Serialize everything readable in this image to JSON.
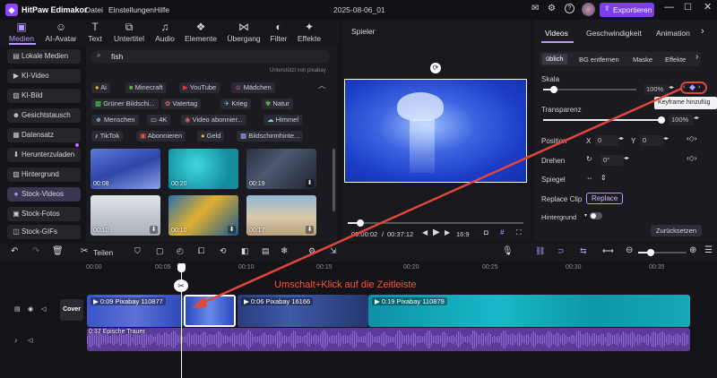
{
  "app": {
    "name": "HitPaw Edimakor",
    "menu": [
      "Datei",
      "Einstellungen",
      "Hilfe"
    ],
    "project_title": "2025-08-06_01",
    "export_label": "Exportieren",
    "accent_color": "#7b3ff2"
  },
  "toolbar": [
    {
      "label": "Medien",
      "icon": "media-icon",
      "active": true
    },
    {
      "label": "AI-Avatar",
      "icon": "avatar-icon"
    },
    {
      "label": "Text",
      "icon": "text-icon"
    },
    {
      "label": "Untertitel",
      "icon": "subtitle-icon"
    },
    {
      "label": "Audio",
      "icon": "audio-icon"
    },
    {
      "label": "Elemente",
      "icon": "elements-icon"
    },
    {
      "label": "Übergang",
      "icon": "transition-icon"
    },
    {
      "label": "Filter",
      "icon": "filter-icon"
    },
    {
      "label": "Effekte",
      "icon": "effects-icon"
    }
  ],
  "sidebar": {
    "items": [
      {
        "label": "Lokale Medien",
        "icon": "folder-icon"
      },
      {
        "label": "KI-Video",
        "icon": "ai-video-icon"
      },
      {
        "label": "KI-Bild",
        "icon": "ai-image-icon"
      },
      {
        "label": "Gesichtstausch",
        "icon": "face-swap-icon"
      },
      {
        "label": "Datensatz",
        "icon": "dataset-icon"
      },
      {
        "label": "Herunterzuladen",
        "icon": "download-icon"
      },
      {
        "label": "Hintergrund",
        "icon": "background-icon"
      },
      {
        "label": "Stock-Videos",
        "icon": "stock-video-icon",
        "active": true
      },
      {
        "label": "Stock-Fotos",
        "icon": "stock-photo-icon"
      },
      {
        "label": "Stock-GIFs",
        "icon": "stock-gif-icon"
      }
    ]
  },
  "media": {
    "search_value": "fish",
    "powered_by": "Unterstützt von pixabay",
    "tags": [
      [
        "Ai",
        "Minecraft",
        "YouTube",
        "Mädchen"
      ],
      [
        "Grüner Bildschi...",
        "Vatertag",
        "Krieg",
        "Natur"
      ],
      [
        "Menschen",
        "4K",
        "Video abonnier...",
        "Himmel"
      ],
      [
        "TikTok",
        "Abonnieren",
        "Geld",
        "Bildschirmhinte..."
      ]
    ],
    "thumbs": [
      {
        "duration": "00:08"
      },
      {
        "duration": "00:20"
      },
      {
        "duration": "00:19"
      },
      {
        "duration": "00:10"
      },
      {
        "duration": "00:10"
      },
      {
        "duration": "00:17"
      }
    ]
  },
  "player": {
    "title": "Spieler",
    "time_current": "00:00:02",
    "time_total": "00:37:12",
    "aspect": "16:9",
    "progress": 0.07
  },
  "props": {
    "tabs": [
      "Videos",
      "Geschwindigkeit",
      "Animation"
    ],
    "subtabs": [
      "üblich",
      "BG entfernen",
      "Maske",
      "Effekte"
    ],
    "scale_label": "Skala",
    "scale_value": "100%",
    "scale_level": 0.12,
    "tooltip": "Keyframe hinzufüg",
    "opacity_label": "Transparenz",
    "opacity_value": "100%",
    "opacity_level": 1.0,
    "position_label": "Position",
    "pos_x_label": "X",
    "pos_x": "0",
    "pos_y_label": "Y",
    "pos_y": "0",
    "rotate_label": "Drehen",
    "rotate_value": "0°",
    "mirror_label": "Spiegel",
    "replace_label": "Replace Clip",
    "replace_button": "Replace",
    "background_label": "Hintergrund",
    "reset_button": "Zurücksetzen"
  },
  "timeline": {
    "split_label": "Teilen",
    "ruler": [
      "00:00",
      "00:05",
      "00:10",
      "00:15",
      "00:20",
      "00:25",
      "00:30",
      "00:35"
    ],
    "cover_label": "Cover",
    "annotation": "Umschalt+Klick auf die Zeitleiste",
    "clips": [
      {
        "label": "0:09 Pixabay 110877",
        "color": "#3a55c8"
      },
      {
        "label": "0:06 Pixabay 16166",
        "color": "#2b3c7e"
      },
      {
        "label": "0:19 Pixabay 110879",
        "color": "#10a8b8"
      }
    ],
    "audio_label": "0:37 Epische Trauer",
    "audio_color": "#6b4bb0",
    "annotation_color": "#e0463c"
  }
}
